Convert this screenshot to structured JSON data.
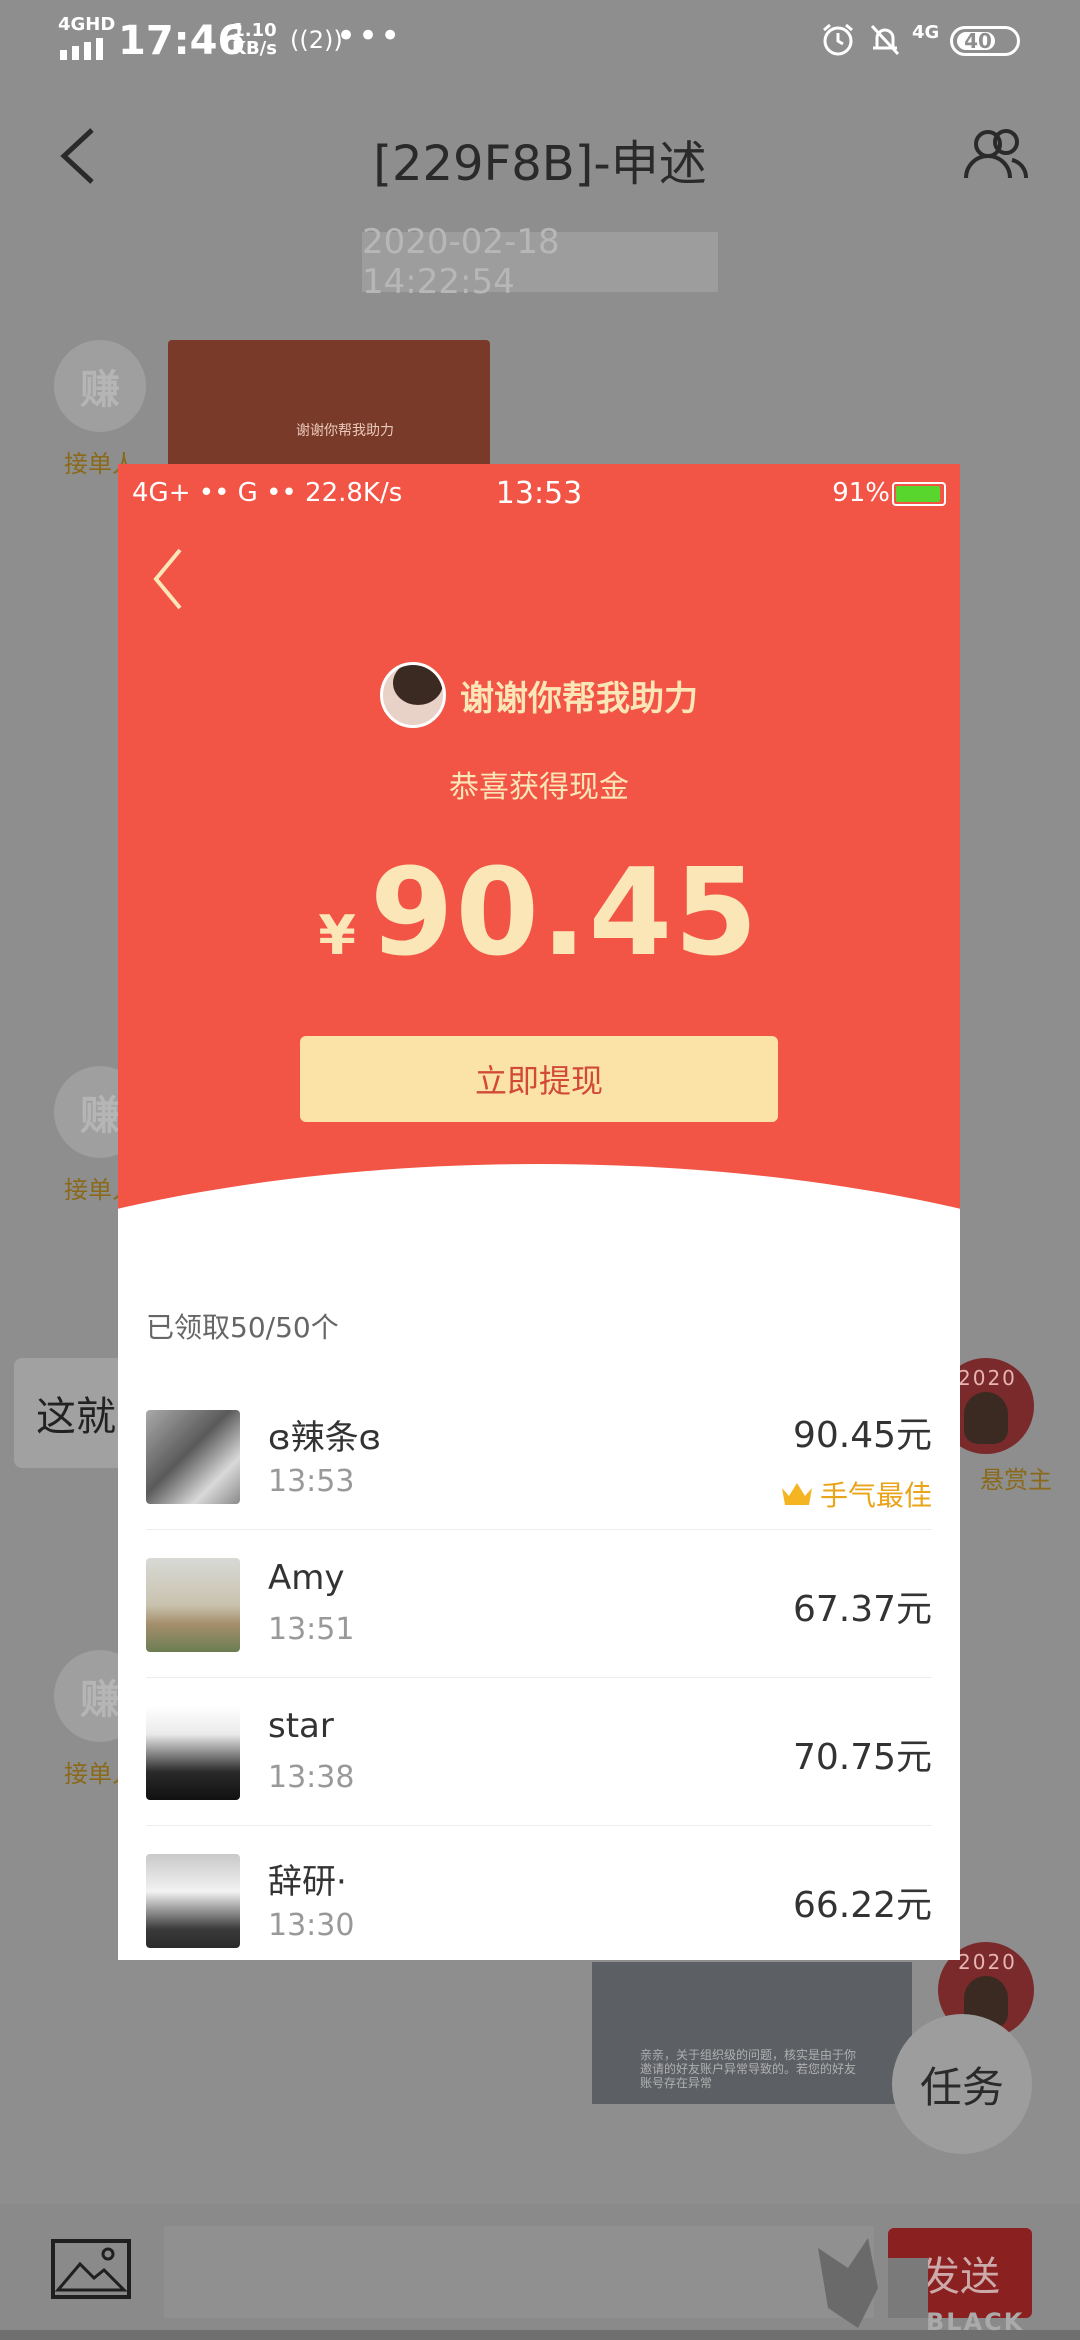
{
  "status_bar": {
    "network": "4GHD",
    "time": "17:46",
    "speed_value": "1.10",
    "speed_unit": "KB/s",
    "hotspot": "2",
    "more": "•••",
    "net_right": "4G",
    "battery": "40"
  },
  "header": {
    "title": "[229F8B]-申述"
  },
  "chat": {
    "timestamp": "2020-02-18 14:22:54",
    "sender_avatar_char": "赚",
    "sender_role": "接单人",
    "partial_message": "这就",
    "right_avatar_year": "2020",
    "right_role": "悬赏主",
    "task_button": "任务",
    "send_button": "发送",
    "thumbnail_text": "谢谢你帮我助力",
    "photo_text": "亲亲，关于组织级的问题，核实是由于你邀请的好友账户异常导致的。若您的好友账号存在异常"
  },
  "packet": {
    "status": {
      "left": "4G+ •• G •• 22.8K/s",
      "time": "13:53",
      "right": "91%"
    },
    "sender_name": "谢谢你帮我助力",
    "subtitle": "恭喜获得现金",
    "currency": "¥",
    "amount": "90.45",
    "withdraw_button": "立即提现",
    "claimed_count": "已领取50/50个",
    "entries": [
      {
        "name": "ɞ辣条ɞ",
        "time": "13:53",
        "amount": "90.45元",
        "badge": "手气最佳"
      },
      {
        "name": "Amy",
        "time": "13:51",
        "amount": "67.37元"
      },
      {
        "name": "star",
        "time": "13:38",
        "amount": "70.75元"
      },
      {
        "name": "辞研·",
        "time": "13:30",
        "amount": "66.22元"
      }
    ]
  },
  "watermark": {
    "text": "BLACK CAT"
  },
  "colors": {
    "packet_red": "#f25546",
    "packet_gold": "#fbe6b8",
    "button_gold": "#fbe3a8",
    "best_luck": "#e9a419",
    "overlay_gray": "#8e8e8e"
  }
}
